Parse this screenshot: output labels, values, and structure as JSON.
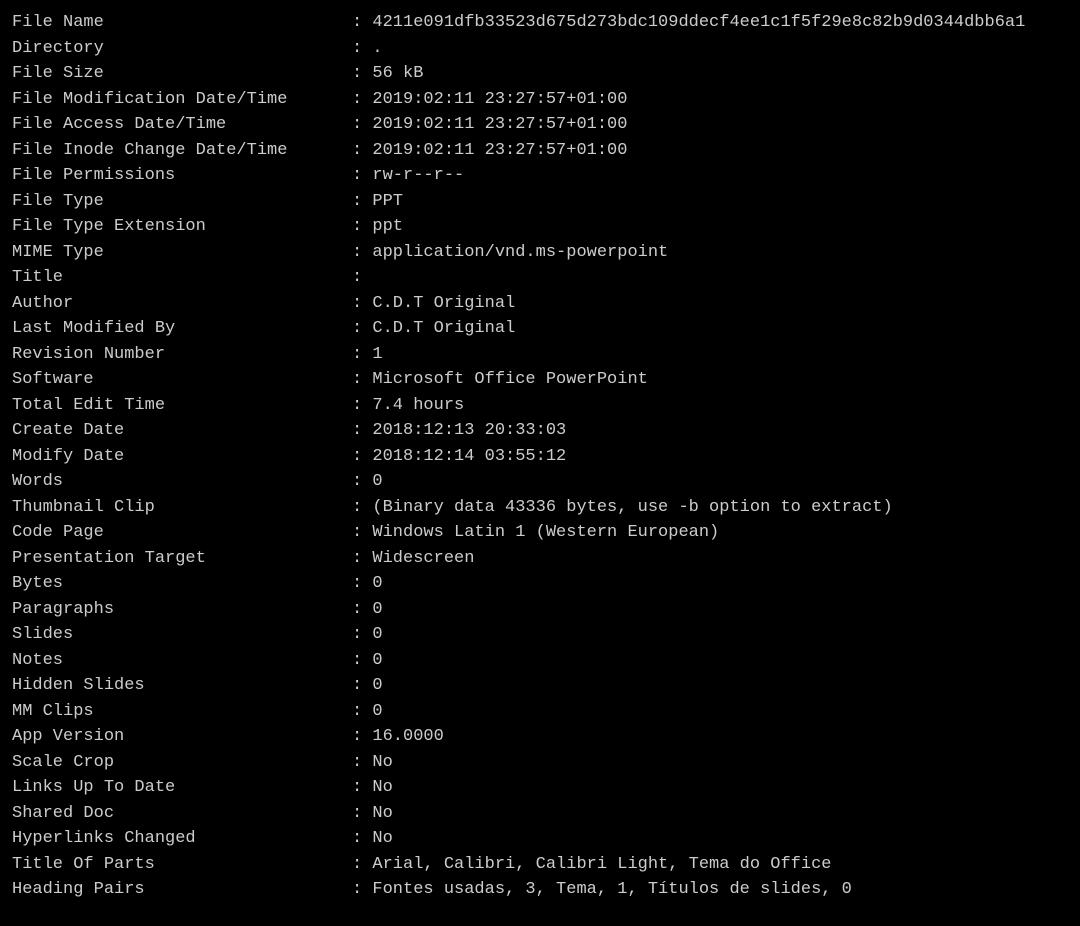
{
  "separator": ": ",
  "rows": [
    {
      "label": "File Name",
      "value": "4211e091dfb33523d675d273bdc109ddecf4ee1c1f5f29e8c82b9d0344dbb6a1"
    },
    {
      "label": "Directory",
      "value": "."
    },
    {
      "label": "File Size",
      "value": "56 kB"
    },
    {
      "label": "File Modification Date/Time",
      "value": "2019:02:11 23:27:57+01:00"
    },
    {
      "label": "File Access Date/Time",
      "value": "2019:02:11 23:27:57+01:00"
    },
    {
      "label": "File Inode Change Date/Time",
      "value": "2019:02:11 23:27:57+01:00"
    },
    {
      "label": "File Permissions",
      "value": "rw-r--r--"
    },
    {
      "label": "File Type",
      "value": "PPT"
    },
    {
      "label": "File Type Extension",
      "value": "ppt"
    },
    {
      "label": "MIME Type",
      "value": "application/vnd.ms-powerpoint"
    },
    {
      "label": "Title",
      "value": ""
    },
    {
      "label": "Author",
      "value": "C.D.T Original"
    },
    {
      "label": "Last Modified By",
      "value": "C.D.T Original"
    },
    {
      "label": "Revision Number",
      "value": "1"
    },
    {
      "label": "Software",
      "value": "Microsoft Office PowerPoint"
    },
    {
      "label": "Total Edit Time",
      "value": "7.4 hours"
    },
    {
      "label": "Create Date",
      "value": "2018:12:13 20:33:03"
    },
    {
      "label": "Modify Date",
      "value": "2018:12:14 03:55:12"
    },
    {
      "label": "Words",
      "value": "0"
    },
    {
      "label": "Thumbnail Clip",
      "value": "(Binary data 43336 bytes, use -b option to extract)"
    },
    {
      "label": "Code Page",
      "value": "Windows Latin 1 (Western European)"
    },
    {
      "label": "Presentation Target",
      "value": "Widescreen"
    },
    {
      "label": "Bytes",
      "value": "0"
    },
    {
      "label": "Paragraphs",
      "value": "0"
    },
    {
      "label": "Slides",
      "value": "0"
    },
    {
      "label": "Notes",
      "value": "0"
    },
    {
      "label": "Hidden Slides",
      "value": "0"
    },
    {
      "label": "MM Clips",
      "value": "0"
    },
    {
      "label": "App Version",
      "value": "16.0000"
    },
    {
      "label": "Scale Crop",
      "value": "No"
    },
    {
      "label": "Links Up To Date",
      "value": "No"
    },
    {
      "label": "Shared Doc",
      "value": "No"
    },
    {
      "label": "Hyperlinks Changed",
      "value": "No"
    },
    {
      "label": "Title Of Parts",
      "value": "Arial, Calibri, Calibri Light, Tema do Office"
    },
    {
      "label": "Heading Pairs",
      "value": "Fontes usadas, 3, Tema, 1, Títulos de slides, 0"
    }
  ]
}
